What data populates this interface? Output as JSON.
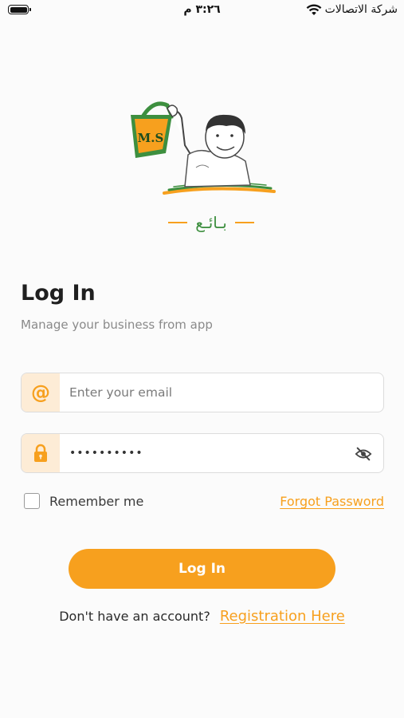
{
  "status_bar": {
    "time": "٣:٢٦ م",
    "carrier": "شركة الاتصالات",
    "battery_icon": "battery-icon",
    "wifi_icon": "wifi-icon"
  },
  "logo": {
    "icon": "ms-logo-icon",
    "bag_text": "M.S",
    "brand_text": "بـائـع"
  },
  "login": {
    "title": "Log In",
    "subtitle": "Manage your business from app"
  },
  "email_field": {
    "icon": "at-sign-icon",
    "placeholder": "Enter your email",
    "value": ""
  },
  "password_field": {
    "icon": "lock-icon",
    "masked_value": "••••••••••",
    "visibility_icon": "eye-off-icon"
  },
  "remember_me": {
    "label": "Remember me",
    "checked": false
  },
  "forgot_password": "Forgot Password",
  "login_button": "Log In",
  "signup": {
    "text": "Don't have an account?",
    "link": "Registration Here"
  },
  "colors": {
    "accent": "#f7a01e",
    "accent_light": "#fdecd6",
    "brand_green": "#3d8f3f",
    "background": "#fbfbfb"
  }
}
